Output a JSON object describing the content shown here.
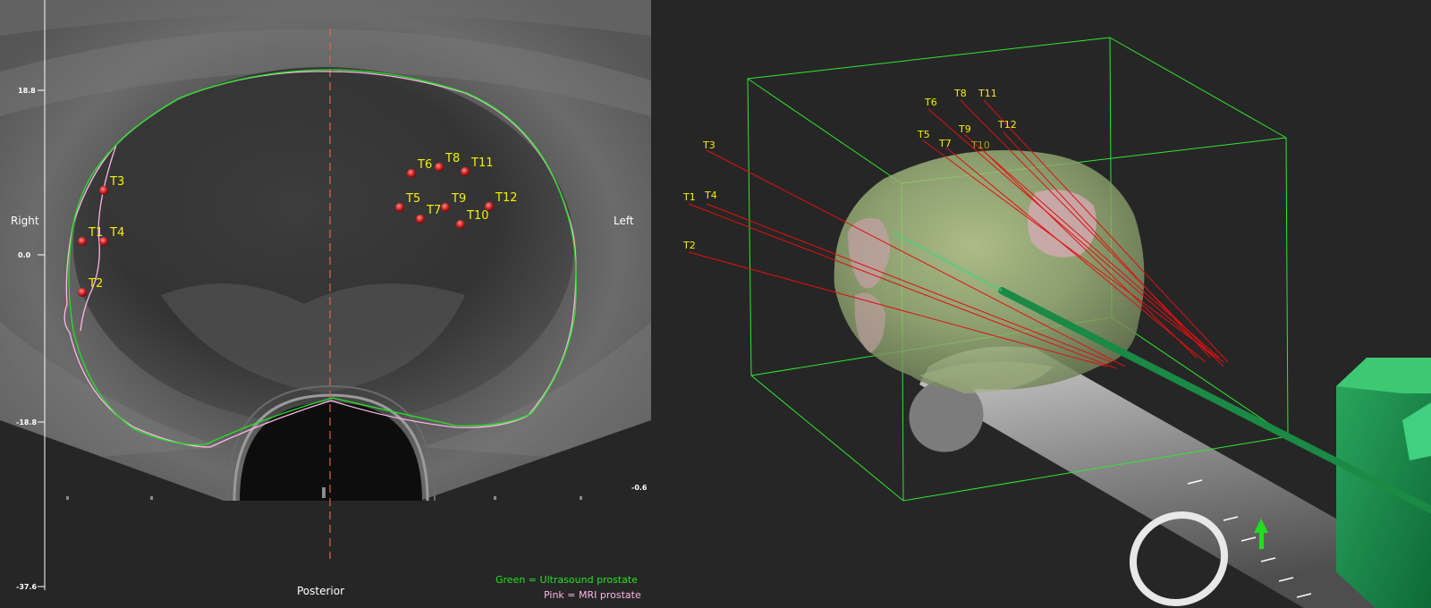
{
  "ultrasound": {
    "orientation": {
      "right": "Right",
      "left": "Left",
      "posterior": "Posterior"
    },
    "y_axis_ticks": [
      "18.8",
      "0.0",
      "-18.8",
      "-37.6"
    ],
    "side_readout": "-0.6",
    "targets": [
      {
        "label": "T1"
      },
      {
        "label": "T2"
      },
      {
        "label": "T3"
      },
      {
        "label": "T4"
      },
      {
        "label": "T5"
      },
      {
        "label": "T6"
      },
      {
        "label": "T7"
      },
      {
        "label": "T8"
      },
      {
        "label": "T9"
      },
      {
        "label": "T10"
      },
      {
        "label": "T11"
      },
      {
        "label": "T12"
      }
    ],
    "legend": {
      "green": "Green = Ultrasound prostate",
      "pink": "Pink = MRI prostate"
    },
    "colors": {
      "ultrasound_contour": "#22e322",
      "mri_contour": "#ffb6e6",
      "target_marker": "#cc2020",
      "label": "#f3f000"
    }
  },
  "view3d": {
    "targets": [
      {
        "label": "T1"
      },
      {
        "label": "T2"
      },
      {
        "label": "T3"
      },
      {
        "label": "T4"
      },
      {
        "label": "T5"
      },
      {
        "label": "T6"
      },
      {
        "label": "T7"
      },
      {
        "label": "T8"
      },
      {
        "label": "T9"
      },
      {
        "label": "T10"
      },
      {
        "label": "T11"
      },
      {
        "label": "T12"
      }
    ],
    "colors": {
      "bounding_box": "#2ee82e",
      "needle": "#1a8a45",
      "trajectory": "#e01010",
      "probe": "#9a9a9a"
    }
  }
}
